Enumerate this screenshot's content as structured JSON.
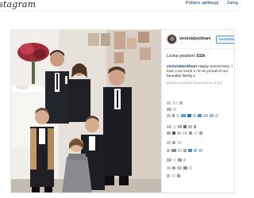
{
  "header": {
    "logo_text": "stagram",
    "get_app_label": "Pobierz aplikację",
    "login_label": "Zalog"
  },
  "post": {
    "username": "victoriabeckham",
    "follow_label": "OBSERWUJ",
    "likes_label": "Liczba polubień:",
    "likes_count": "632k",
    "caption_user": "victoriabeckham",
    "caption_text": " Happy anniversary. I love u so much x I'm so proud of our beautiful family x",
    "view_more_comments": "pokaż wszystkie komentarze (9,52)",
    "photo_description": "family-portrait-photo"
  },
  "colors": {
    "link": "#003569",
    "accent": "#3897f0",
    "muted": "#a0a0a0",
    "border": "#e6e6e6"
  }
}
